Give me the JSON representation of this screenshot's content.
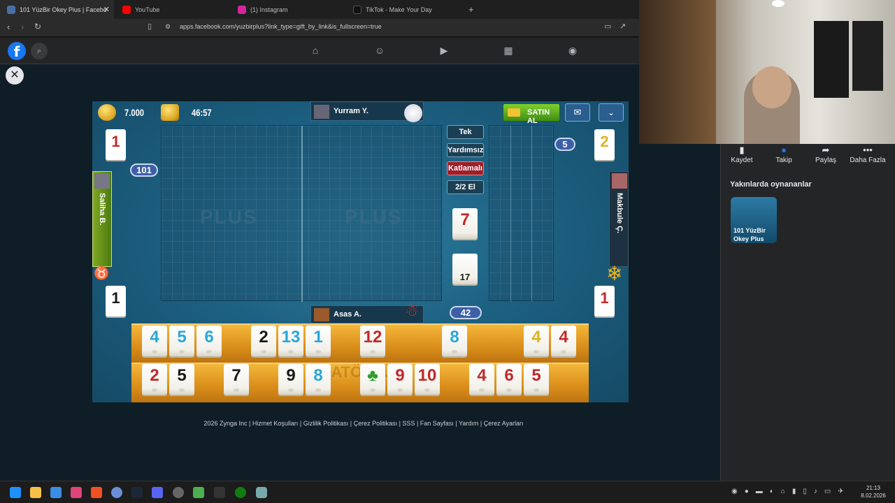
{
  "browser": {
    "tabs": [
      {
        "title": "101 YüzBir Okey Plus | Facebo",
        "active": true,
        "fav_color": "#4a6fa5"
      },
      {
        "title": "YouTube",
        "active": false,
        "fav_color": "#ff0000"
      },
      {
        "title": "(1) Instagram",
        "active": false,
        "fav_color": "#d6249f"
      },
      {
        "title": "TikTok - Make Your Day",
        "active": false,
        "fav_color": "#111111"
      }
    ],
    "new_tab": "+",
    "url": "apps.facebook.com/yuzbirplus?link_type=gift_by_link&is_fullscreen=true"
  },
  "facebook": {
    "logo": "f",
    "nav_icons": [
      "home-icon",
      "friends-icon",
      "video-icon",
      "marketplace-icon",
      "groups-icon"
    ]
  },
  "game": {
    "coins": "7.000",
    "timer": "46:57",
    "buy_label": "SATIN AL",
    "players": {
      "top": "Yurram Y.",
      "left": "Saliha B.",
      "right": "Makbule Ç.",
      "bottom": "Asas A."
    },
    "board_logo": "PLUS",
    "modes": [
      "Tek",
      "Yardımsız",
      "Katlamalı",
      "2/2 El"
    ],
    "indicator_tile": "7",
    "remaining_tiles": "17",
    "score_left": "101",
    "score_right": "5",
    "score_bottom": "42",
    "seat_tiles": {
      "top_left": "1",
      "top_right": "2",
      "bottom_left": "1",
      "bottom_right": "1"
    },
    "rack_watermark": "MATÖRLÜ",
    "rack_top": [
      {
        "v": "4",
        "c": "blue"
      },
      {
        "v": "5",
        "c": "blue"
      },
      {
        "v": "6",
        "c": "blue"
      },
      {
        "v": "",
        "c": "none"
      },
      {
        "v": "2",
        "c": "black"
      },
      {
        "v": "13",
        "c": "blue"
      },
      {
        "v": "1",
        "c": "blue"
      },
      {
        "v": "",
        "c": "none"
      },
      {
        "v": "12",
        "c": "red"
      },
      {
        "v": "",
        "c": "none"
      },
      {
        "v": "",
        "c": "none"
      },
      {
        "v": "8",
        "c": "blue"
      },
      {
        "v": "",
        "c": "none"
      },
      {
        "v": "",
        "c": "none"
      },
      {
        "v": "4",
        "c": "yellow"
      },
      {
        "v": "4",
        "c": "red"
      }
    ],
    "rack_bottom": [
      {
        "v": "2",
        "c": "red"
      },
      {
        "v": "5",
        "c": "black"
      },
      {
        "v": "",
        "c": "none"
      },
      {
        "v": "7",
        "c": "black"
      },
      {
        "v": "",
        "c": "none"
      },
      {
        "v": "9",
        "c": "black"
      },
      {
        "v": "8",
        "c": "blue"
      },
      {
        "v": "",
        "c": "none"
      },
      {
        "v": "♣",
        "c": "joker"
      },
      {
        "v": "9",
        "c": "red"
      },
      {
        "v": "10",
        "c": "red"
      },
      {
        "v": "",
        "c": "none"
      },
      {
        "v": "4",
        "c": "red"
      },
      {
        "v": "6",
        "c": "red"
      },
      {
        "v": "5",
        "c": "red"
      }
    ]
  },
  "footer": "2026 Zynga Inc | Hizmet Koşulları | Gizlilik Politikası | Çerez Politikası | SSS | Fan Sayfası | Yardım | Çerez Ayarları",
  "sidebar": {
    "actions": [
      "Kaydet",
      "Takip",
      "Paylaş",
      "Daha Fazla"
    ],
    "recent_title": "Yakınlarda oynananlar",
    "recent_game": "101 YüzBir Okey Plus"
  },
  "taskbar": {
    "time": "21:13",
    "date": "8.02.2026"
  }
}
